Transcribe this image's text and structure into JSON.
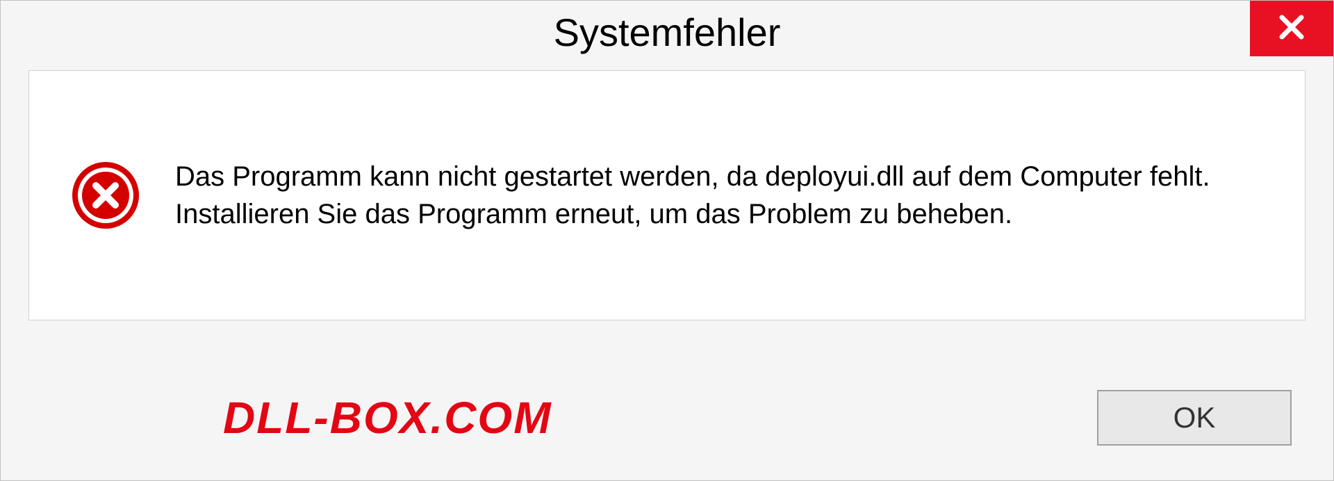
{
  "dialog": {
    "title": "Systemfehler",
    "message": "Das Programm kann nicht gestartet werden, da deployui.dll auf dem Computer fehlt. Installieren Sie das Programm erneut, um das Problem zu beheben.",
    "ok_label": "OK"
  },
  "watermark": "DLL-BOX.COM"
}
